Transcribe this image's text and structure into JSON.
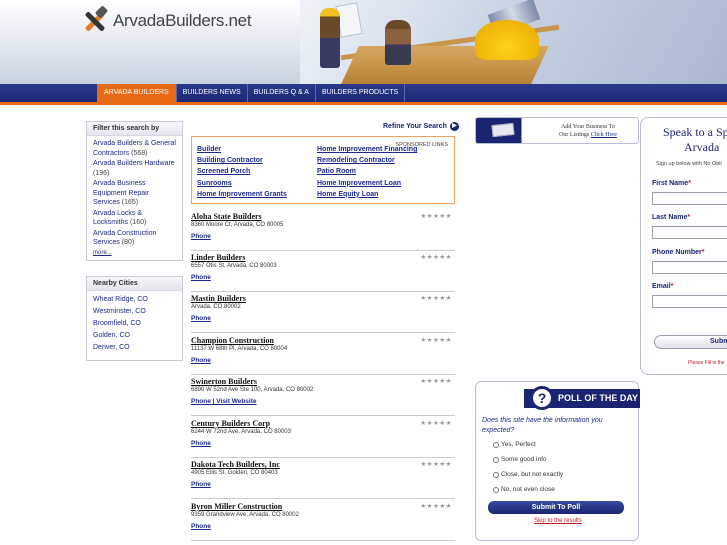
{
  "site": {
    "name": "ArvadaBuilders.net"
  },
  "nav": [
    {
      "label": "ARVADA BUILDERS",
      "active": true
    },
    {
      "label": "BUILDERS NEWS",
      "active": false
    },
    {
      "label": "BUILDERS Q & A",
      "active": false
    },
    {
      "label": "BUILDERS PRODUCTS",
      "active": false
    }
  ],
  "filter": {
    "title": "Filter this search by",
    "items": [
      {
        "label": "Arvada Builders & General Contractors",
        "count": "(568)"
      },
      {
        "label": "Arvada Builders Hardware",
        "count": "(196)"
      },
      {
        "label": "Arvada Business Equipment Repair Services",
        "count": "(165)"
      },
      {
        "label": "Arvada Locks & Locksmiths",
        "count": "(160)"
      },
      {
        "label": "Arvada Construction Services",
        "count": "(80)"
      }
    ],
    "more": "more..."
  },
  "nearby": {
    "title": "Nearby Cities",
    "items": [
      "Wheat Ridge, CO",
      "Westminster, CO",
      "Broomfield, CO",
      "Golden, CO",
      "Denver, CO"
    ]
  },
  "refine": {
    "label": "Refine Your Search"
  },
  "sponsored": {
    "tag": "SPONSORED LINKS",
    "left": [
      "Builder",
      "Building Contractor",
      "Screened Porch",
      "Sunrooms",
      "Home Improvement Grants"
    ],
    "right": [
      "Home Improvement Financing",
      "Remodeling Contractor",
      "Patio Room",
      "Home Improvement Loan",
      "Home Equity Loan"
    ]
  },
  "listings": [
    {
      "name": "Aloha State Builders",
      "address": "8360 Moore Ct, Arvada, CO 80005",
      "links": "Phone"
    },
    {
      "name": "Linder Builders",
      "address": "6557 Otis St, Arvada, CO 80003",
      "links": "Phone"
    },
    {
      "name": "Mastin Builders",
      "address": "Arvada, CO 80002",
      "links": "Phone"
    },
    {
      "name": "Champion Construction",
      "address": "11137 W 68th Pl, Arvada, CO 80004",
      "links": "Phone"
    },
    {
      "name": "Swinerton Builders",
      "address": "6890 W 52nd Ave Ste 100, Arvada, CO 80002",
      "links": "Phone | Visit Website"
    },
    {
      "name": "Century Builders Corp",
      "address": "6244 W 72nd Ave, Arvada, CO 80003",
      "links": "Phone"
    },
    {
      "name": "Dakota Tech Builders, Inc",
      "address": "4905 Ellis St, Golden, CO 80403",
      "links": "Phone"
    },
    {
      "name": "Byron Miller Construction",
      "address": "9359 Grandview Ave, Arvada, CO 80002",
      "links": "Phone"
    }
  ],
  "stars": "★★★★★",
  "ad": {
    "line1": "Add Your Business To",
    "line2": "Our Listings",
    "link": "Click Here"
  },
  "poll": {
    "title": "POLL OF THE DAY",
    "icon": "?",
    "question": "Does this site have the information you expected?",
    "options": [
      "Yes, Perfect",
      "Some good info",
      "Close, but not exactly",
      "No, not even close"
    ],
    "submit": "Submit To Poll",
    "skip": "Skip to the results"
  },
  "lead": {
    "heading1": "Speak to a Sp",
    "heading2": "Arvada",
    "sub": "Sign up below with No Obli",
    "fields": [
      "First Name",
      "Last Name",
      "Phone Number",
      "Email"
    ],
    "req": "*",
    "submit": "Subm",
    "note": "Please Fill in the"
  },
  "colors": {
    "navy": "#1a2470",
    "orange": "#e86a16",
    "link": "#1a2a8a"
  }
}
